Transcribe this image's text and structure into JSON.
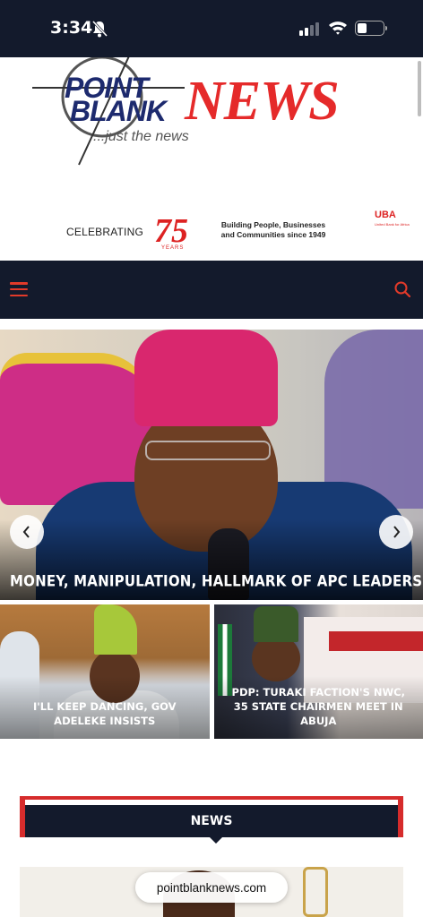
{
  "status": {
    "time": "3:34"
  },
  "logo": {
    "point": "POINT",
    "blank": "BLANK",
    "news": "NEWS",
    "tagline": "...just the news"
  },
  "ad": {
    "celebrating": "CELEBRATING",
    "seventyfive": "75",
    "years": "YEARS",
    "building": "Building People, Businesses and Communities since 1949",
    "uba": "UBA",
    "uba_sub": "United Bank for Africa"
  },
  "hero": {
    "title": "MONEY, MANIPULATION, HALLMARK OF APC LEADERSHIP-MARK"
  },
  "thumbs": [
    {
      "title": "I'LL KEEP DANCING, GOV ADELEKE INSISTS"
    },
    {
      "title": "PDP: TURAKI FACTION'S NWC, 35 STATE CHAIRMEN MEET IN ABUJA"
    }
  ],
  "section": {
    "news_label": "NEWS"
  },
  "browser": {
    "url": "pointblanknews.com"
  },
  "colors": {
    "navy": "#131a2c",
    "red": "#d62c2c"
  }
}
